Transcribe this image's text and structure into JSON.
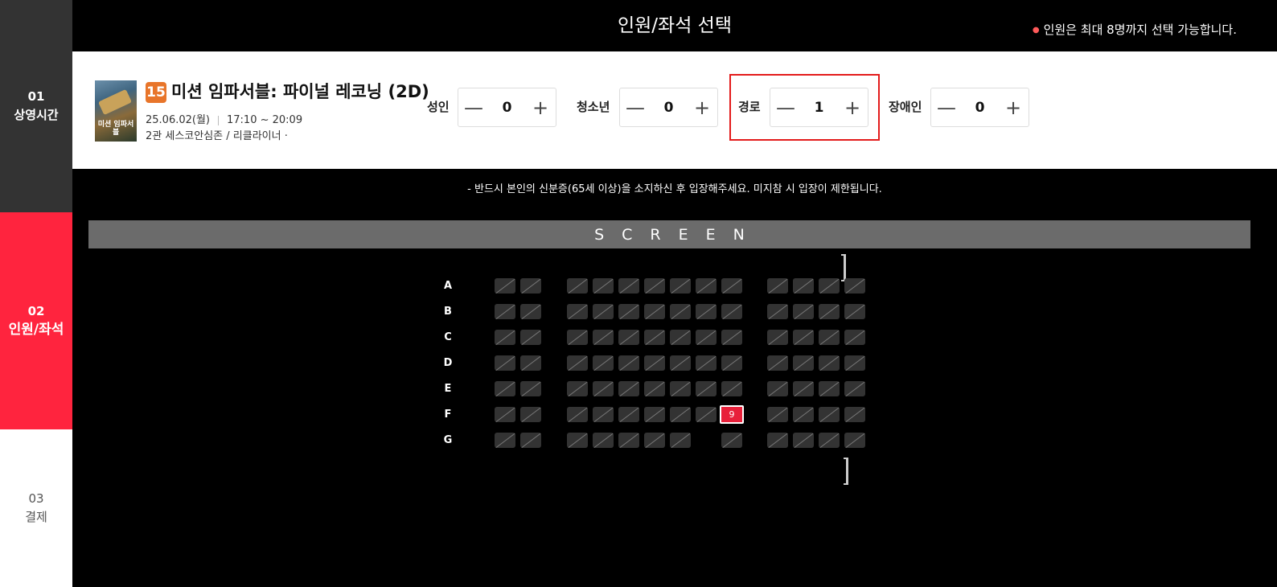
{
  "steps": [
    {
      "num": "01",
      "label": "상영시간"
    },
    {
      "num": "02",
      "label": "인원/좌석"
    },
    {
      "num": "03",
      "label": "결제"
    }
  ],
  "header": {
    "title": "인원/좌석 선택",
    "notice": "인원은 최대 8명까지 선택 가능합니다."
  },
  "movie": {
    "rating": "15",
    "title": "미션 임파서블: 파이널 레코닝 (2D)",
    "date": "25.06.02(월)",
    "time": "17:10 ~ 20:09",
    "hall": "2관 세스코안심존 / 리클라이너 ·",
    "poster_text": "미션 임파서블"
  },
  "counters": [
    {
      "label": "성인",
      "value": "0"
    },
    {
      "label": "청소년",
      "value": "0"
    },
    {
      "label": "경로",
      "value": "1"
    },
    {
      "label": "장애인",
      "value": "0"
    }
  ],
  "counter_symbols": {
    "minus": "—",
    "plus": "+"
  },
  "message": "-  반드시 본인의 신분증(65세 이상)을 소지하신 후 입장해주세요. 미지참 시 입장이 제한됩니다.",
  "screen_label": "SCREEN",
  "rows": [
    "A",
    "B",
    "C",
    "D",
    "E",
    "F",
    "G"
  ],
  "selected_seat": {
    "row": "F",
    "number": "9"
  },
  "colors": {
    "accent": "#ff243e",
    "selected_seat": "#e8203a",
    "highlight": "#e31b1b",
    "rating": "#e8752a"
  }
}
